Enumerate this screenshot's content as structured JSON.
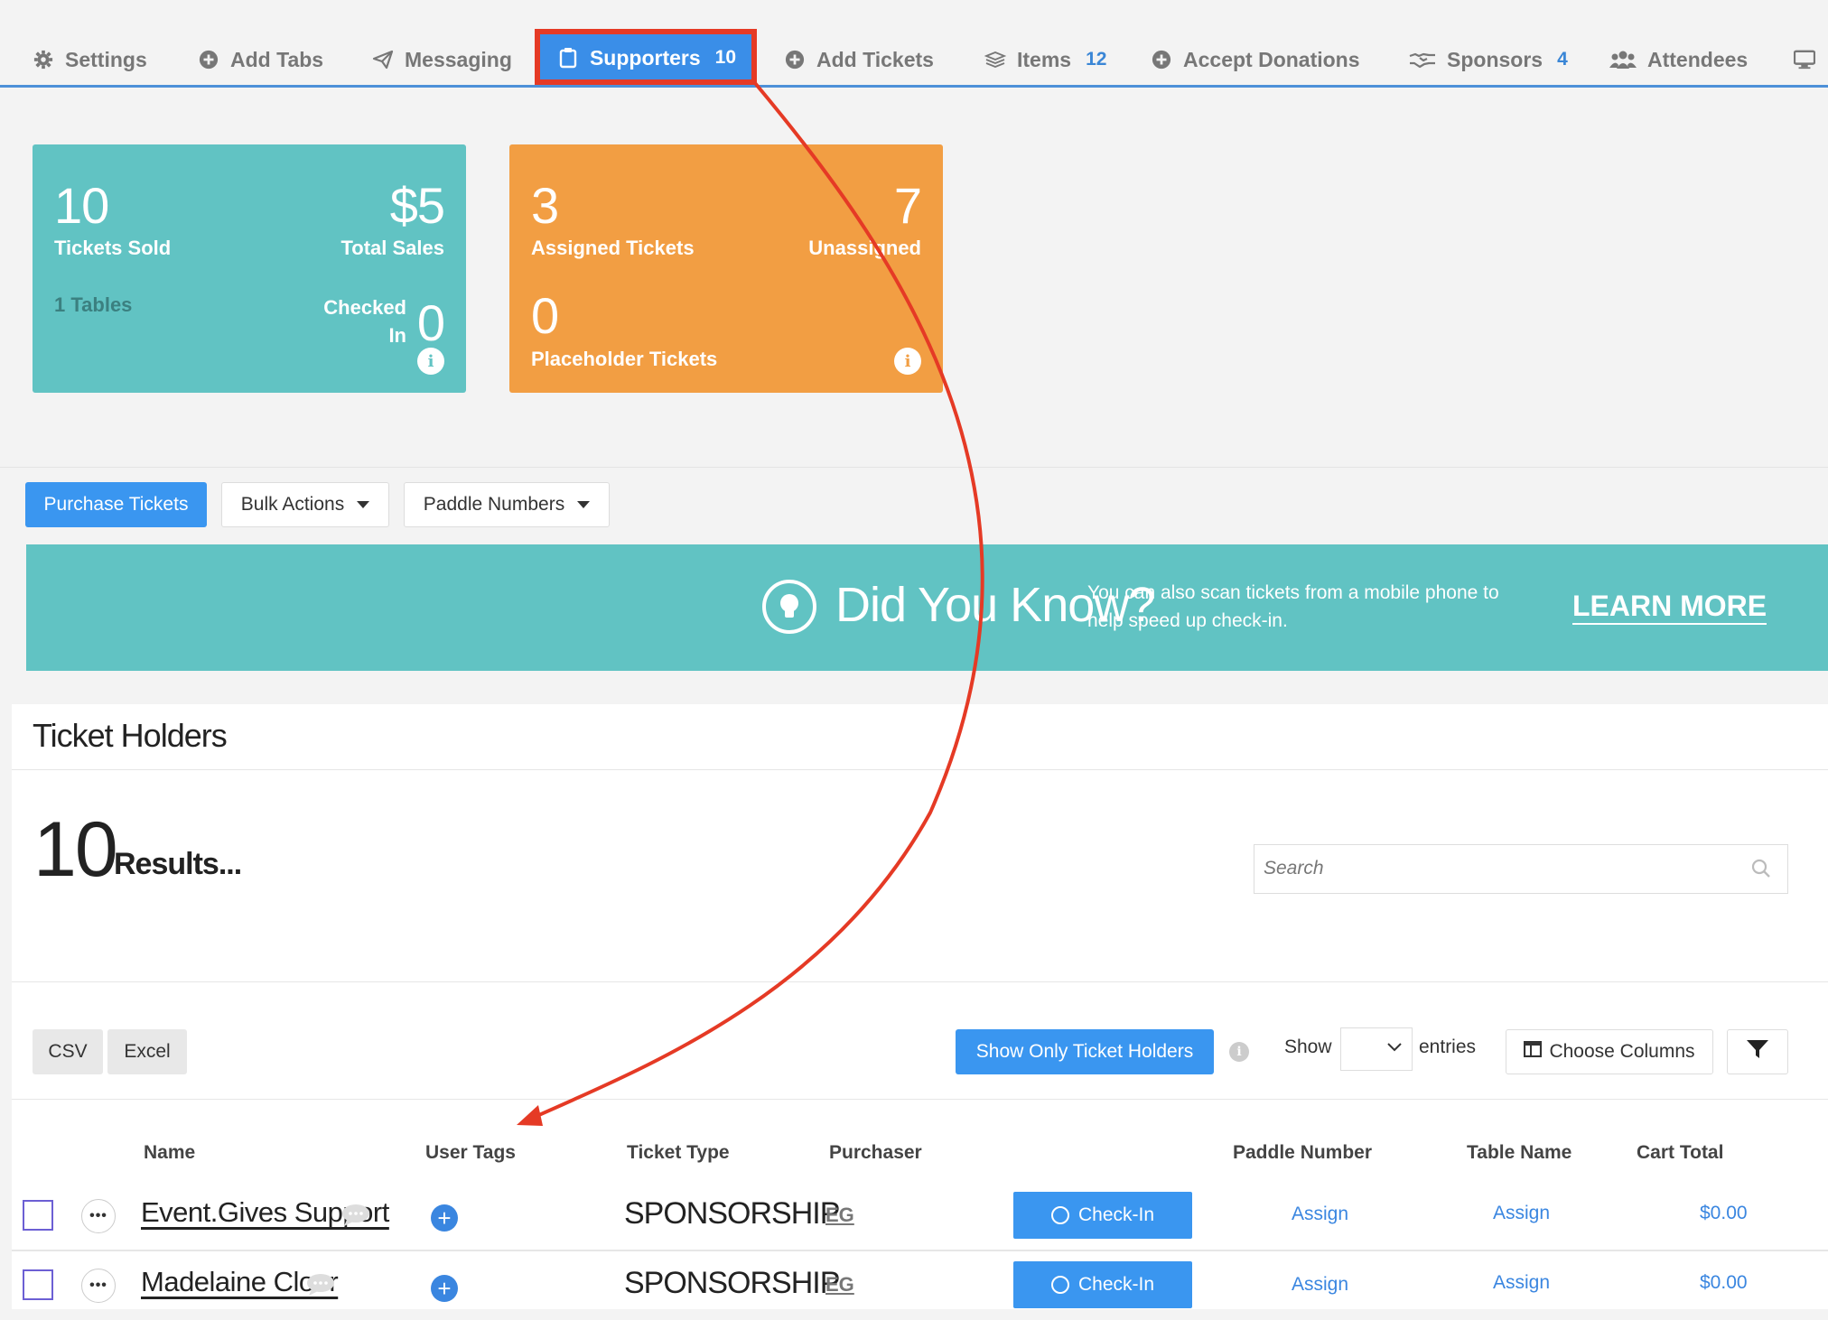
{
  "tabs": [
    {
      "label": "Settings",
      "icon": "gear-icon"
    },
    {
      "label": "Add Tabs",
      "icon": "plus-circle-icon"
    },
    {
      "label": "Messaging",
      "icon": "paper-plane-icon"
    },
    {
      "label": "Supporters",
      "icon": "clipboard-icon",
      "count": "10",
      "active": true
    },
    {
      "label": "Add Tickets",
      "icon": "plus-circle-icon"
    },
    {
      "label": "Items",
      "icon": "layers-icon",
      "count": "12"
    },
    {
      "label": "Accept Donations",
      "icon": "plus-circle-icon"
    },
    {
      "label": "Sponsors",
      "icon": "handshake-icon",
      "count": "4"
    },
    {
      "label": "Attendees",
      "icon": "users-icon"
    },
    {
      "label": "",
      "icon": "monitor-icon"
    }
  ],
  "cards": {
    "tickets_sold_value": "10",
    "tickets_sold_label": "Tickets Sold",
    "total_sales_value": "$5",
    "total_sales_label": "Total Sales",
    "tables_label": "1 Tables",
    "checked_in_label_1": "Checked",
    "checked_in_label_2": "In",
    "checked_in_value": "0",
    "assigned_value": "3",
    "assigned_label": "Assigned Tickets",
    "unassigned_value": "7",
    "unassigned_label": "Unassigned",
    "placeholder_value": "0",
    "placeholder_label": "Placeholder Tickets",
    "info_glyph": "i"
  },
  "actions": {
    "purchase": "Purchase Tickets",
    "bulk": "Bulk Actions",
    "paddle": "Paddle Numbers"
  },
  "banner": {
    "title": "Did You Know?",
    "text": "You can also scan tickets from a mobile phone to help speed up check-in.",
    "link": "LEARN MORE"
  },
  "panel": {
    "title": "Ticket Holders",
    "results_count": "10",
    "results_label": "Results...",
    "search_placeholder": "Search",
    "csv": "CSV",
    "excel": "Excel",
    "show_only": "Show Only Ticket Holders",
    "show": "Show",
    "entries": "entries",
    "choose_columns": "Choose Columns"
  },
  "table": {
    "headers": {
      "name": "Name",
      "tags": "User Tags",
      "type": "Ticket Type",
      "purchaser": "Purchaser",
      "paddle": "Paddle Number",
      "table": "Table Name",
      "cart": "Cart Total"
    },
    "rows": [
      {
        "name": "Event.Gives Support",
        "type": "SPONSORSHIP",
        "purchaser": "EG",
        "checkin": "Check-In",
        "paddle": "Assign",
        "table": "Assign",
        "cart": "$0.00"
      },
      {
        "name": "Madelaine Cloer",
        "type": "SPONSORSHIP",
        "purchaser": "EG",
        "checkin": "Check-In",
        "paddle": "Assign",
        "table": "Assign",
        "cart": "$0.00"
      }
    ]
  },
  "colors": {
    "teal": "#61c3c3",
    "orange": "#f29e43",
    "blue": "#3a96f0",
    "annotation_red": "#e53a25"
  }
}
